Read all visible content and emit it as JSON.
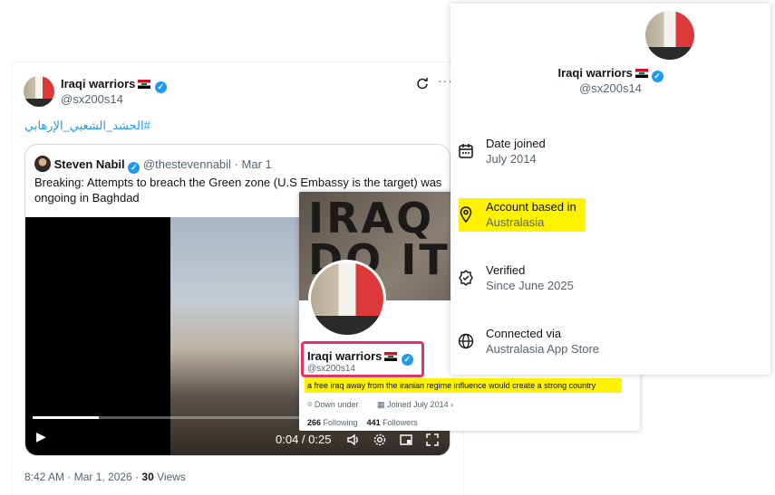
{
  "tweet": {
    "name": "Iraqi warriors",
    "handle": "@sx200s14",
    "hashtag": "#الحشد_الشعبي_الإرهابي",
    "refresh_icon": "refresh-icon",
    "more_icon": "more-icon",
    "quote": {
      "name": "Steven Nabil",
      "handle": "@thestevennabil",
      "date": "· Mar 1",
      "text": "Breaking: Attempts to breach the Green zone (U.S Embassy is the target) was ongoing in Baghdad",
      "video": {
        "time": "0:04 / 0:25",
        "progress": 0.16
      }
    },
    "timestamp": "8:42 AM · Mar 1, 2026 ·",
    "views_count": "30",
    "views_label": "Views"
  },
  "hover_card": {
    "banner_text": "IRAQ\nDO IT",
    "name": "Iraqi warriors",
    "handle": "@sx200s14",
    "bio": "a free iraq away from the iranian regime influence would create a strong country",
    "location": "Down under",
    "joined": "Joined July 2014",
    "following_count": "266",
    "following_label": "Following",
    "followers_count": "441",
    "followers_label": "Followers"
  },
  "account_panel": {
    "name": "Iraqi warriors",
    "handle": "@sx200s14",
    "rows": [
      {
        "label": "Date joined",
        "value": "July 2014",
        "icon": "calendar-icon"
      },
      {
        "label": "Account based in",
        "value": "Australasia",
        "icon": "location-pin-icon"
      },
      {
        "label": "Verified",
        "value": "Since June 2025",
        "icon": "verified-badge-icon"
      },
      {
        "label": "Connected via",
        "value": "Australasia App Store",
        "icon": "globe-icon"
      }
    ]
  },
  "colors": {
    "accent": "#1d9bf0",
    "highlight": "#fff200",
    "outline": "#e6326b"
  }
}
